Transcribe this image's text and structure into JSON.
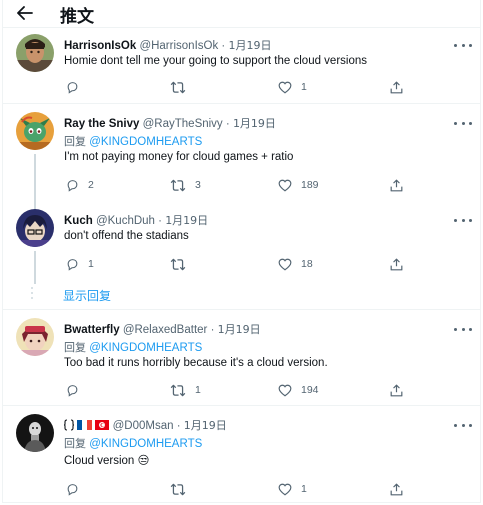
{
  "header": {
    "title": "推文",
    "back_icon": "arrow-left-icon"
  },
  "colors": {
    "accent": "#1d9bf0",
    "text": "#0f1419",
    "muted": "#536471",
    "line": "#cfd9de"
  },
  "show_replies_label": "显示回复",
  "tweets": [
    {
      "name": "HarrisonIsOk",
      "handle": "@HarrisonIsOk",
      "separator": "·",
      "time": "1月19日",
      "replying_label": "",
      "replying_to": "",
      "text": "Homie dont tell me your going to support the cloud versions",
      "emoji": "",
      "reply_count": "",
      "retweet_count": "",
      "like_count": "1"
    },
    {
      "name": "Ray the Snivy",
      "handle": "@RayTheSnivy",
      "separator": "·",
      "time": "1月19日",
      "replying_label": "回复",
      "replying_to": "@KINGDOMHEARTS",
      "text": "I'm not paying money for cloud games + ratio",
      "emoji": "",
      "reply_count": "2",
      "retweet_count": "3",
      "like_count": "189"
    },
    {
      "name": "Kuch",
      "handle": "@KuchDuh",
      "separator": "·",
      "time": "1月19日",
      "replying_label": "",
      "replying_to": "",
      "text": "don't offend the stadians",
      "emoji": "",
      "reply_count": "1",
      "retweet_count": "",
      "like_count": "18"
    },
    {
      "name": "Bwatterfly",
      "handle": "@RelaxedBatter",
      "separator": "·",
      "time": "1月19日",
      "replying_label": "回复",
      "replying_to": "@KINGDOMHEARTS",
      "text": "Too bad it runs horribly because it's a cloud version.",
      "emoji": "",
      "reply_count": "",
      "retweet_count": "1",
      "like_count": "194"
    },
    {
      "name": "",
      "handle": "@D00Msan",
      "separator": "·",
      "time": "1月19日",
      "replying_label": "回复",
      "replying_to": "@KINGDOMHEARTS",
      "text": "Cloud version",
      "emoji": "😒",
      "reply_count": "",
      "retweet_count": "",
      "like_count": "1"
    }
  ]
}
